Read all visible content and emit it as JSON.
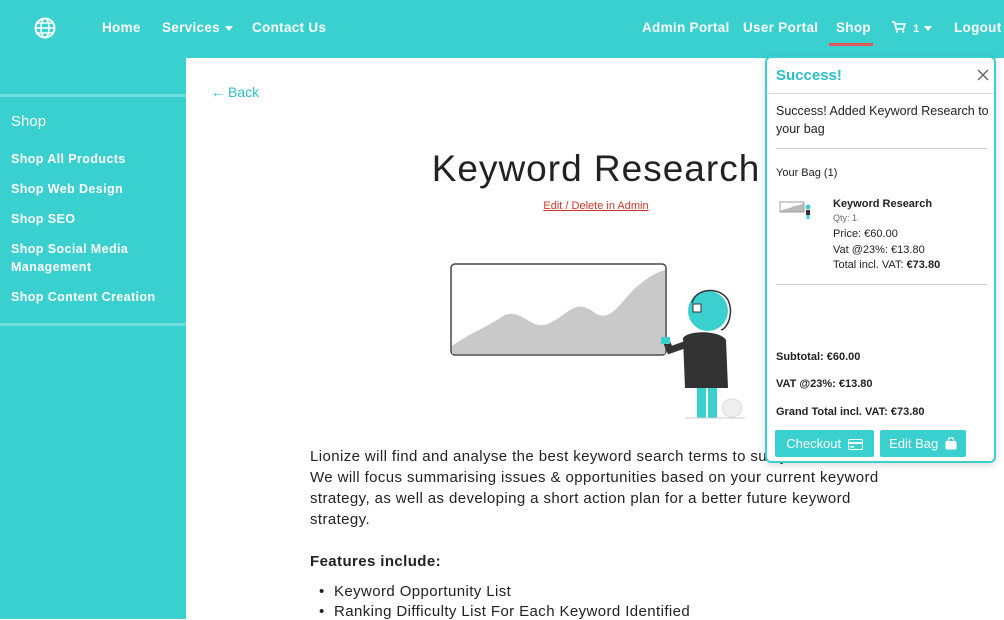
{
  "nav": {
    "logo_icon": "globe-icon",
    "home": "Home",
    "services": "Services",
    "contact": "Contact Us",
    "admin_portal": "Admin Portal",
    "user_portal": "User Portal",
    "shop": "Shop",
    "cart_count": "1",
    "logout": "Logout",
    "accent_color": "#3bd0d0",
    "active_underline_color": "#e05a5a"
  },
  "sidebar": {
    "title": "Shop",
    "items": [
      "Shop All Products",
      "Shop Web Design",
      "Shop SEO",
      "Shop Social Media Management",
      "Shop Content Creation"
    ]
  },
  "main": {
    "back": "Back",
    "title": "Keyword Research",
    "admin_link": "Edit / Delete in Admin",
    "description": "Lionize will find and analyse the best keyword search terms to suit your website. We will focus summarising issues & opportunities based on your current keyword strategy, as well as developing a short action plan for a better future keyword strategy.",
    "features_heading": "Features include:",
    "features": [
      "Keyword Opportunity List",
      "Ranking Difficulty List For Each Keyword Identified"
    ]
  },
  "popup": {
    "title": "Success!",
    "message": "Success! Added Keyword Research to your bag",
    "bag_title": "Your Bag (1)",
    "item": {
      "name": "Keyword Research",
      "qty": "Qty: 1",
      "price": "Price: €60.00",
      "vat": "Vat @23%: €13.80",
      "total_label": "Total incl. VAT: ",
      "total_value": "€73.80"
    },
    "subtotal": "Subtotal: €60.00",
    "vat_total": "VAT @23%: €13.80",
    "grand_total": "Grand Total incl. VAT: €73.80",
    "checkout": "Checkout",
    "edit_bag": "Edit Bag"
  }
}
